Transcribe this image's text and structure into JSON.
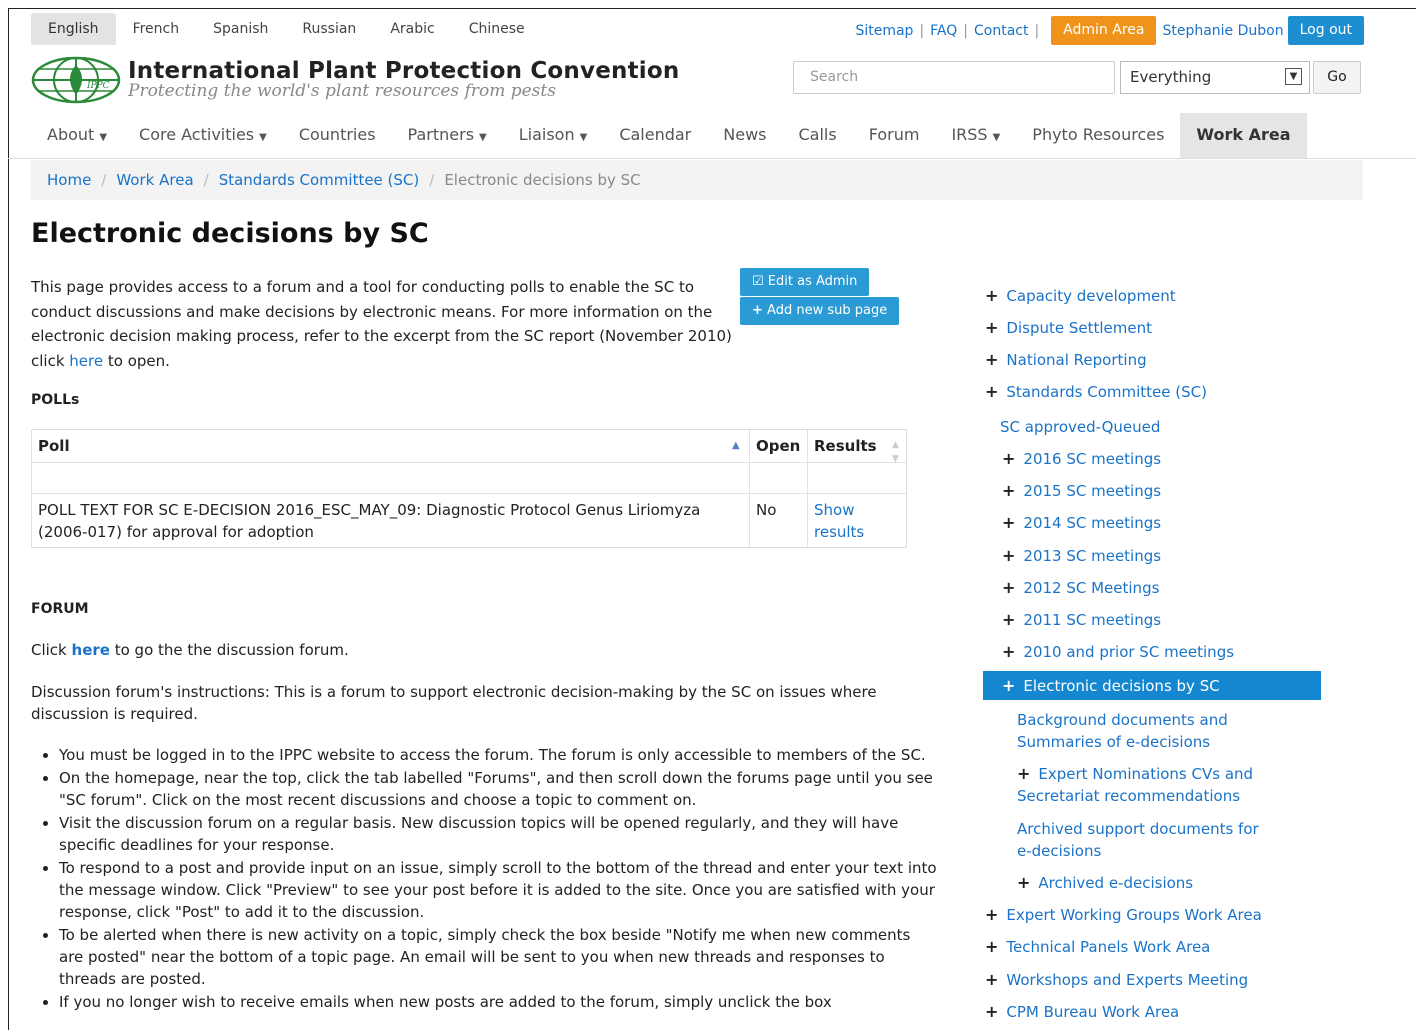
{
  "languages": [
    "English",
    "French",
    "Spanish",
    "Russian",
    "Arabic",
    "Chinese"
  ],
  "toplinks": {
    "sitemap": "Sitemap",
    "faq": "FAQ",
    "contact": "Contact",
    "admin": "Admin Area",
    "user": "Stephanie Dubon",
    "logout": "Log out"
  },
  "header": {
    "title": "International Plant Protection Convention",
    "subtitle": "Protecting the world's plant resources from pests",
    "logo_text": "IPPC"
  },
  "search": {
    "placeholder": "Search",
    "scope": "Everything",
    "go": "Go"
  },
  "nav": [
    {
      "label": "About",
      "dropdown": true
    },
    {
      "label": "Core Activities",
      "dropdown": true
    },
    {
      "label": "Countries",
      "dropdown": false
    },
    {
      "label": "Partners",
      "dropdown": true
    },
    {
      "label": "Liaison",
      "dropdown": true
    },
    {
      "label": "Calendar",
      "dropdown": false
    },
    {
      "label": "News",
      "dropdown": false
    },
    {
      "label": "Calls",
      "dropdown": false
    },
    {
      "label": "Forum",
      "dropdown": false
    },
    {
      "label": "IRSS",
      "dropdown": true
    },
    {
      "label": "Phyto Resources",
      "dropdown": false
    },
    {
      "label": "Work Area",
      "dropdown": false,
      "active": true
    }
  ],
  "breadcrumb": {
    "home": "Home",
    "work_area": "Work Area",
    "sc": "Standards Committee (SC)",
    "current": "Electronic decisions by SC"
  },
  "page": {
    "title": "Electronic decisions by SC",
    "intro_before": "This page provides access to a forum and a tool for conducting polls to enable the SC to conduct discussions and make decisions by electronic means. For more information on the electronic decision making process, refer to the excerpt from the SC report (November 2010) click ",
    "intro_link": "here",
    "intro_after": " to open.",
    "edit_admin": "Edit as Admin",
    "add_sub": "Add new sub page",
    "polls_heading": "POLLs",
    "forum_heading": "FORUM",
    "forum_click_before": "Click ",
    "forum_click_link": "here",
    "forum_click_after": " to go the the discussion forum.",
    "forum_instructions": "Discussion forum's instructions: This is a forum to support electronic decision-making by the SC on issues where discussion is required.",
    "bullets": [
      "You must be logged in to the IPPC website to access the forum. The forum is only accessible to members of the SC.",
      "On the homepage, near the top, click the tab labelled \"Forums\", and then scroll down the forums page until you see \"SC forum\". Click on the most recent discussions and choose a topic to comment on.",
      "Visit the discussion forum on a regular basis. New discussion topics will be opened regularly, and they will have specific deadlines for your response.",
      "To respond to a post and provide input on an issue, simply scroll to the bottom of the thread and enter your text into the message window. Click \"Preview\" to see your post before it is added to the site. Once you are satisfied with your response, click \"Post\" to add it to the discussion.",
      "To be alerted when there is new activity on a topic, simply check the box beside \"Notify me when new comments are posted\" near the bottom of a topic page. An email will be sent to you when new threads and responses to threads are posted.",
      "If you no longer wish to receive emails when new posts are added to the forum, simply unclick the box"
    ]
  },
  "polls_table": {
    "headers": {
      "poll": "Poll",
      "open": "Open",
      "results": "Results"
    },
    "row": {
      "poll": "POLL TEXT FOR SC E-DECISION 2016_ESC_MAY_09: Diagnostic Protocol Genus Liriomyza (2006-017) for approval for adoption",
      "open": "No",
      "results": "Show results"
    }
  },
  "sidebar": [
    {
      "label": "Capacity development",
      "plus": true
    },
    {
      "label": "Dispute Settlement",
      "plus": true
    },
    {
      "label": "National Reporting",
      "plus": true
    },
    {
      "label": "Standards Committee (SC)",
      "plus": true
    },
    {
      "label": "SC approved-Queued",
      "plus": false
    },
    {
      "label": "2016 SC meetings",
      "plus": true
    },
    {
      "label": "2015 SC meetings",
      "plus": true
    },
    {
      "label": "2014 SC meetings",
      "plus": true
    },
    {
      "label": "2013 SC meetings",
      "plus": true
    },
    {
      "label": "2012 SC Meetings",
      "plus": true
    },
    {
      "label": "2011 SC meetings",
      "plus": true
    },
    {
      "label": "2010 and prior SC meetings",
      "plus": true
    },
    {
      "label": "Electronic decisions by SC",
      "plus": true,
      "active": true
    },
    {
      "label": "Background documents and",
      "plus": false
    },
    {
      "label": "Summaries of e-decisions",
      "plus": false
    },
    {
      "label": "Expert Nominations CVs and",
      "plus": true
    },
    {
      "label": "Secretariat recommendations",
      "plus": false
    },
    {
      "label": "Archived support documents for",
      "plus": false
    },
    {
      "label": "e-decisions",
      "plus": false
    },
    {
      "label": "Archived e-decisions",
      "plus": true
    },
    {
      "label": "Expert Working Groups Work Area",
      "plus": true
    },
    {
      "label": "Technical Panels Work Area",
      "plus": true
    },
    {
      "label": "Workshops and Experts Meeting",
      "plus": true
    },
    {
      "label": "CPM Bureau Work Area",
      "plus": true
    }
  ]
}
